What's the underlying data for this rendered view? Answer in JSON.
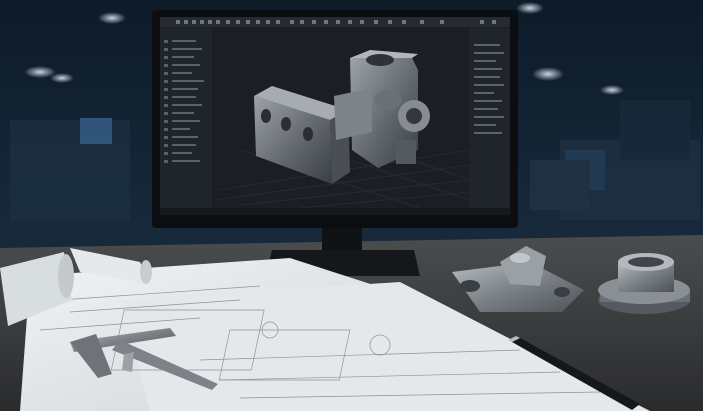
{
  "scene": {
    "description_free": true,
    "monitor_brand": "",
    "colors": {
      "workshop_bg": "#16283a",
      "desk": "#3a3d40",
      "screen_bg": "#1b1f25",
      "paper": "#e9ecee",
      "metal": "#8a8f94"
    }
  }
}
